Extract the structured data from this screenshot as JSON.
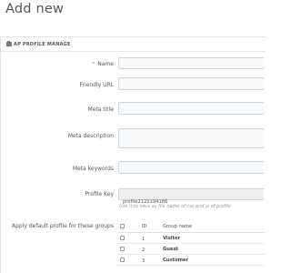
{
  "page": {
    "title": "Add new"
  },
  "panel": {
    "icon": "gear-icon",
    "title": "AP PROFILE MANAGE"
  },
  "form": {
    "name": {
      "label": "Name",
      "required_mark": "*",
      "value": ""
    },
    "friendly_url": {
      "label": "Friendly URL",
      "value": ""
    },
    "meta_title": {
      "label": "Meta title",
      "value": ""
    },
    "meta_description": {
      "label": "Meta description",
      "value": ""
    },
    "meta_keywords": {
      "label": "Meta keywords",
      "value": ""
    },
    "profile_key": {
      "label": "Profile Key",
      "value": "profile2121194186",
      "help": "Use it to save as file name of css and js of profile"
    },
    "groups": {
      "label": "Apply default profile for these groups",
      "columns": [
        "ID",
        "Group name"
      ],
      "rows": [
        {
          "id": "1",
          "name": "Visitor"
        },
        {
          "id": "2",
          "name": "Guest"
        },
        {
          "id": "3",
          "name": "Customer"
        }
      ]
    }
  }
}
